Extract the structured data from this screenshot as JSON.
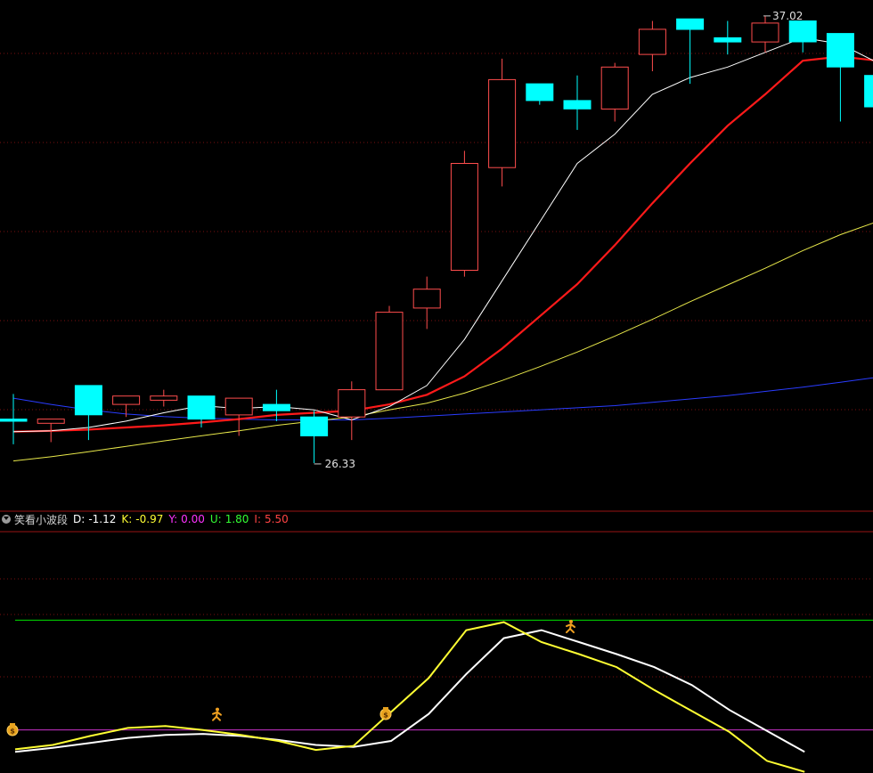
{
  "colors": {
    "up": "#ff4d4d",
    "down": "#00ffff",
    "ma5": "#ffffff",
    "ma10": "#ff1a1a",
    "ma30": "#e8e84a",
    "ma60": "#2a3cff",
    "grid": "#7a1010",
    "k_line": "#ffff33",
    "d_line": "#ffffff",
    "upper_band": "#00e000",
    "lower_band": "#cc33cc"
  },
  "icons": {
    "buy": "money-bag-icon",
    "sell": "running-man-icon"
  },
  "indicator": {
    "title": "笑看小波段",
    "items": [
      {
        "label": "D:",
        "value": "-1.12",
        "color": "#ffffff"
      },
      {
        "label": "K:",
        "value": "-0.97",
        "color": "#ffff33"
      },
      {
        "label": "Y:",
        "value": "0.00",
        "color": "#ff33ff"
      },
      {
        "label": "U:",
        "value": "1.80",
        "color": "#33ff33"
      },
      {
        "label": "I:",
        "value": "5.50",
        "color": "#ff4444"
      }
    ]
  },
  "chart_data": [
    {
      "type": "candlestick",
      "ylim": [
        25.5,
        37.4
      ],
      "annotations": {
        "high": {
          "value": 37.02,
          "label": "37.02",
          "index": 20
        },
        "low": {
          "value": 26.33,
          "label": "26.33",
          "index": 8
        }
      },
      "candles": [
        {
          "o": 27.4,
          "h": 28.0,
          "l": 26.8,
          "c": 27.35
        },
        {
          "o": 27.3,
          "h": 27.4,
          "l": 26.85,
          "c": 27.4
        },
        {
          "o": 28.2,
          "h": 28.2,
          "l": 26.9,
          "c": 27.5
        },
        {
          "o": 27.75,
          "h": 27.9,
          "l": 27.45,
          "c": 27.95
        },
        {
          "o": 27.85,
          "h": 28.1,
          "l": 27.7,
          "c": 27.95
        },
        {
          "o": 27.95,
          "h": 27.95,
          "l": 27.2,
          "c": 27.4
        },
        {
          "o": 27.5,
          "h": 27.9,
          "l": 27.0,
          "c": 27.9
        },
        {
          "o": 27.75,
          "h": 28.1,
          "l": 27.35,
          "c": 27.6
        },
        {
          "o": 27.45,
          "h": 27.6,
          "l": 26.35,
          "c": 27.0
        },
        {
          "o": 27.45,
          "h": 28.3,
          "l": 26.9,
          "c": 28.1
        },
        {
          "o": 28.1,
          "h": 30.1,
          "l": 28.1,
          "c": 29.95
        },
        {
          "o": 30.05,
          "h": 30.8,
          "l": 29.55,
          "c": 30.5
        },
        {
          "o": 30.95,
          "h": 33.8,
          "l": 30.8,
          "c": 33.5
        },
        {
          "o": 33.4,
          "h": 36.0,
          "l": 32.95,
          "c": 35.5
        },
        {
          "o": 35.4,
          "h": 35.4,
          "l": 34.9,
          "c": 35.0
        },
        {
          "o": 35.0,
          "h": 35.6,
          "l": 34.3,
          "c": 34.8
        },
        {
          "o": 34.8,
          "h": 35.9,
          "l": 34.5,
          "c": 35.8
        },
        {
          "o": 36.1,
          "h": 36.9,
          "l": 35.7,
          "c": 36.7
        },
        {
          "o": 36.95,
          "h": 36.95,
          "l": 35.4,
          "c": 36.7
        },
        {
          "o": 36.5,
          "h": 36.9,
          "l": 36.1,
          "c": 36.4
        },
        {
          "o": 36.4,
          "h": 37.02,
          "l": 36.15,
          "c": 36.85
        },
        {
          "o": 36.9,
          "h": 36.9,
          "l": 36.15,
          "c": 36.4
        },
        {
          "o": 36.6,
          "h": 36.6,
          "l": 34.5,
          "c": 35.8
        },
        {
          "o": 35.6,
          "h": 35.6,
          "l": 34.4,
          "c": 34.85
        }
      ],
      "ma": {
        "ma5": [
          27.1,
          27.12,
          27.2,
          27.35,
          27.55,
          27.72,
          27.65,
          27.7,
          27.62,
          27.38,
          27.7,
          28.2,
          29.3,
          30.7,
          32.1,
          33.5,
          34.2,
          35.15,
          35.55,
          35.8,
          36.15,
          36.5,
          36.35,
          35.9
        ],
        "ma10": [
          27.1,
          27.12,
          27.15,
          27.2,
          27.25,
          27.32,
          27.4,
          27.5,
          27.55,
          27.6,
          27.75,
          27.98,
          28.42,
          29.08,
          29.85,
          30.62,
          31.55,
          32.55,
          33.5,
          34.4,
          35.15,
          35.95,
          36.05,
          35.95
        ],
        "ma30": [
          26.4,
          26.5,
          26.62,
          26.75,
          26.88,
          27.0,
          27.12,
          27.25,
          27.35,
          27.45,
          27.62,
          27.78,
          28.02,
          28.32,
          28.65,
          29.0,
          29.38,
          29.78,
          30.2,
          30.6,
          31.0,
          31.42,
          31.8,
          32.12
        ],
        "ma60": [
          27.9,
          27.75,
          27.62,
          27.52,
          27.46,
          27.42,
          27.4,
          27.38,
          27.38,
          27.38,
          27.42,
          27.47,
          27.52,
          27.57,
          27.62,
          27.67,
          27.72,
          27.8,
          27.88,
          27.96,
          28.06,
          28.16,
          28.28,
          28.4
        ]
      }
    },
    {
      "type": "line",
      "name": "笑看小波段",
      "ylim": [
        -1.8,
        9.8
      ],
      "series": [
        {
          "name": "D",
          "values": [
            -1.1,
            -0.9,
            -0.65,
            -0.4,
            -0.25,
            -0.2,
            -0.3,
            -0.5,
            -0.75,
            -0.85,
            -0.55,
            0.8,
            2.8,
            4.6,
            5.0,
            4.4,
            3.8,
            3.15,
            2.25,
            1.0,
            -0.05,
            -1.1
          ]
        },
        {
          "name": "K",
          "values": [
            -0.97,
            -0.75,
            -0.3,
            0.1,
            0.2,
            0.0,
            -0.25,
            -0.55,
            -1.0,
            -0.8,
            0.9,
            2.6,
            5.0,
            5.4,
            4.4,
            3.8,
            3.15,
            2.0,
            0.95,
            -0.1,
            -1.55,
            -2.1
          ]
        }
      ],
      "levels": {
        "upper": 5.5,
        "mid": 1.8,
        "lower": 0.0
      },
      "buy_signals": [
        0,
        10
      ],
      "sell_signals": [
        5,
        15
      ]
    }
  ]
}
